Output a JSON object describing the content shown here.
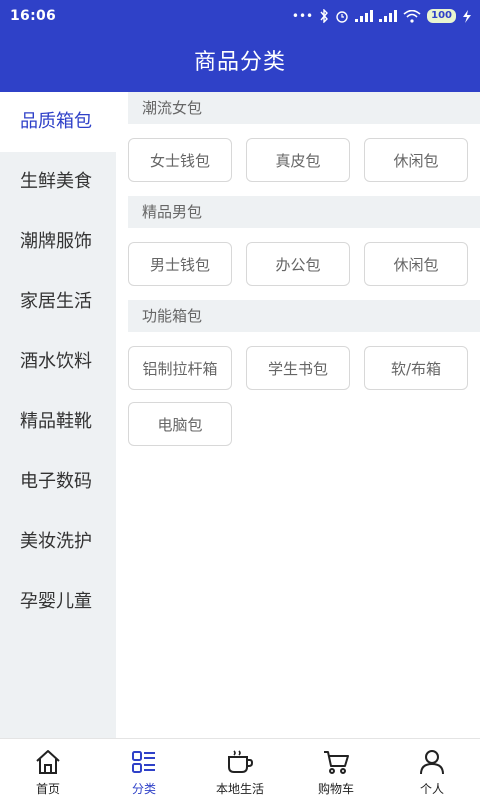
{
  "status_bar": {
    "time": "16:06",
    "battery": "100"
  },
  "header": {
    "title": "商品分类"
  },
  "sidebar": {
    "items": [
      {
        "label": "品质箱包",
        "active": true
      },
      {
        "label": "生鲜美食"
      },
      {
        "label": "潮牌服饰"
      },
      {
        "label": "家居生活"
      },
      {
        "label": "酒水饮料"
      },
      {
        "label": "精品鞋靴"
      },
      {
        "label": "电子数码"
      },
      {
        "label": "美妆洗护"
      },
      {
        "label": "孕婴儿童"
      }
    ]
  },
  "sections": [
    {
      "title": "潮流女包",
      "tags": [
        "女士钱包",
        "真皮包",
        "休闲包"
      ]
    },
    {
      "title": "精品男包",
      "tags": [
        "男士钱包",
        "办公包",
        "休闲包"
      ]
    },
    {
      "title": "功能箱包",
      "tags": [
        "铝制拉杆箱",
        "学生书包",
        "软/布箱",
        "电脑包"
      ]
    }
  ],
  "tabbar": {
    "tabs": [
      {
        "label": "首页",
        "icon": "home-icon"
      },
      {
        "label": "分类",
        "icon": "category-icon",
        "active": true
      },
      {
        "label": "本地生活",
        "icon": "coffee-cup-icon"
      },
      {
        "label": "购物车",
        "icon": "cart-icon"
      },
      {
        "label": "个人",
        "icon": "user-icon"
      }
    ]
  },
  "colors": {
    "brand": "#2f41c8",
    "sidebar_bg": "#eef1f3",
    "tag_border": "#d8d8d8"
  }
}
